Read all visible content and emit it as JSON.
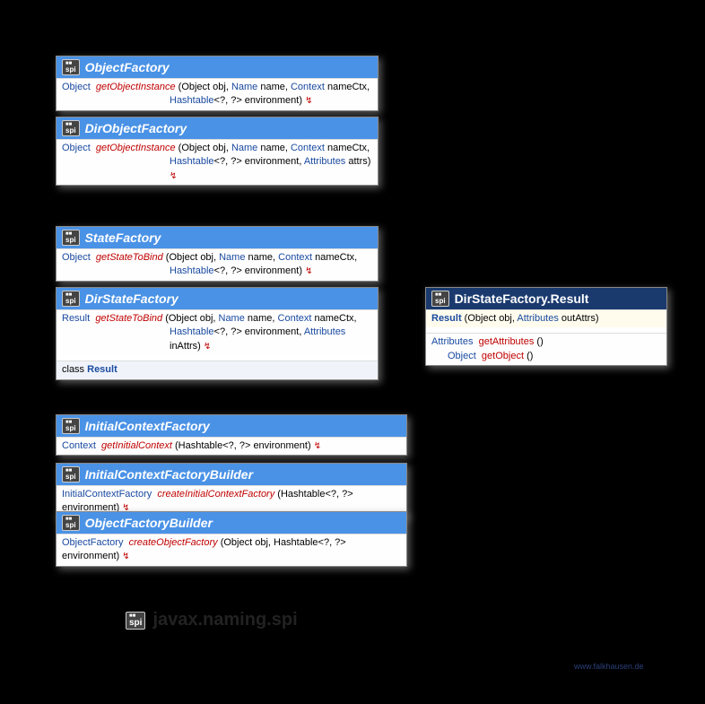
{
  "package_name": "javax.naming.spi",
  "watermark": "www.falkhausen.de",
  "spi_label": "spi",
  "boxes": {
    "objectFactory": {
      "title": "ObjectFactory",
      "retType": "Object",
      "method": "getObjectInstance",
      "sig1": " (Object obj, ",
      "name1": "Name",
      "sig2": " name, ",
      "ctx": "Context",
      "sig3": " nameCtx,",
      "line2a": "Hashtable",
      "line2b": "<?, ?> environment) ",
      "throws": "↯"
    },
    "dirObjectFactory": {
      "title": "DirObjectFactory",
      "retType": "Object",
      "method": "getObjectInstance",
      "sig1": " (Object obj, ",
      "name1": "Name",
      "sig2": " name, ",
      "ctx": "Context",
      "sig3": " nameCtx,",
      "line2a": "Hashtable",
      "line2b": "<?, ?> environment, ",
      "attrs": "Attributes",
      "line2c": " attrs) ",
      "throws": "↯"
    },
    "stateFactory": {
      "title": "StateFactory",
      "retType": "Object",
      "method": "getStateToBind",
      "sig1": " (Object obj, ",
      "name1": "Name",
      "sig2": " name, ",
      "ctx": "Context",
      "sig3": " nameCtx,",
      "line2a": "Hashtable",
      "line2b": "<?, ?> environment) ",
      "throws": "↯"
    },
    "dirStateFactory": {
      "title": "DirStateFactory",
      "retType": "Result",
      "method": "getStateToBind",
      "sig1": " (Object obj, ",
      "name1": "Name",
      "sig2": " name, ",
      "ctx": "Context",
      "sig3": " nameCtx,",
      "line2a": "Hashtable",
      "line2b": "<?, ?> environment, ",
      "attrs": "Attributes",
      "line2c": " inAttrs) ",
      "throws": "↯",
      "nestedKw": "class",
      "nestedName": "Result"
    },
    "result": {
      "title": "DirStateFactory.Result",
      "ctor": "Result",
      "ctorSig1": " (Object obj, ",
      "attrs": "Attributes",
      "ctorSig2": " outAttrs)",
      "m1ret": "Attributes",
      "m1": "getAttributes",
      "m1p": " ()",
      "m2ret": "Object",
      "m2": "getObject",
      "m2p": " ()"
    },
    "initialContextFactory": {
      "title": "InitialContextFactory",
      "retType": "Context",
      "method": "getInitialContext",
      "sig": " (Hashtable<?, ?> environment) ",
      "throws": "↯"
    },
    "initialContextFactoryBuilder": {
      "title": "InitialContextFactoryBuilder",
      "retType": "InitialContextFactory",
      "method": "createInitialContextFactory",
      "sig": " (Hashtable<?, ?> environment) ",
      "throws": "↯"
    },
    "objectFactoryBuilder": {
      "title": "ObjectFactoryBuilder",
      "retType": "ObjectFactory",
      "method": "createObjectFactory",
      "sig": " (Object obj, Hashtable<?, ?> environment) ",
      "throws": "↯"
    }
  }
}
